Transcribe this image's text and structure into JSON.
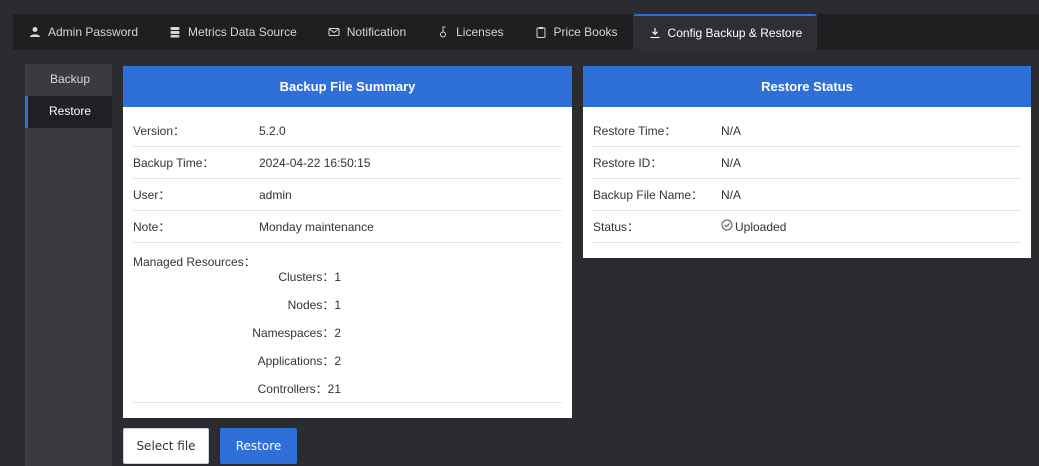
{
  "tabs": [
    {
      "label": "Admin Password",
      "icon": "user-icon"
    },
    {
      "label": "Metrics Data Source",
      "icon": "database-icon"
    },
    {
      "label": "Notification",
      "icon": "mail-icon"
    },
    {
      "label": "Licenses",
      "icon": "key-icon"
    },
    {
      "label": "Price Books",
      "icon": "clipboard-icon"
    },
    {
      "label": "Config Backup & Restore",
      "icon": "download-icon",
      "active": true
    }
  ],
  "subnav": {
    "items": [
      {
        "label": "Backup"
      },
      {
        "label": "Restore",
        "active": true
      }
    ]
  },
  "backup_summary": {
    "title": "Backup File Summary",
    "rows": [
      {
        "key": "Version：",
        "value": "5.2.0"
      },
      {
        "key": "Backup Time：",
        "value": "2024-04-22 16:50:15"
      },
      {
        "key": "User：",
        "value": "admin"
      },
      {
        "key": "Note：",
        "value": "Monday maintenance"
      }
    ],
    "managed_label": "Managed Resources：",
    "resources": [
      "Clusters：1",
      "Nodes：1",
      "Namespaces：2",
      "Applications：2",
      "Controllers：21"
    ]
  },
  "restore_status": {
    "title": "Restore Status",
    "rows": [
      {
        "key": "Restore Time：",
        "value": "N/A"
      },
      {
        "key": "Restore ID：",
        "value": "N/A"
      },
      {
        "key": "Backup File Name：",
        "value": "N/A"
      }
    ],
    "status_key": "Status：",
    "status_value": "Uploaded"
  },
  "buttons": {
    "select_file": "Select file",
    "restore": "Restore"
  },
  "colors": {
    "accent": "#2f6fd8",
    "background": "#2b2c30",
    "tabbar": "#1f1f22"
  }
}
